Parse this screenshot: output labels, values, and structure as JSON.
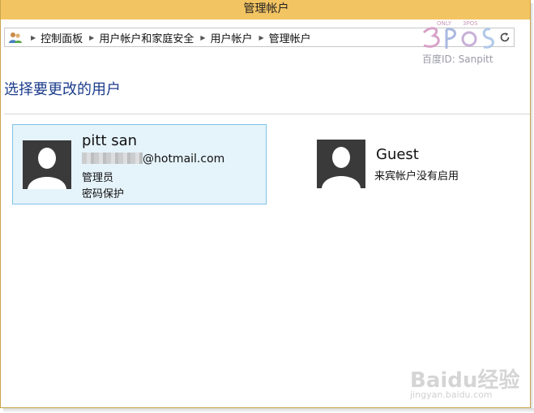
{
  "window": {
    "title": "管理帐户"
  },
  "addressbar": {
    "breadcrumbs": [
      "控制面板",
      "用户帐户和家庭安全",
      "用户帐户",
      "管理帐户"
    ],
    "icon": "users-icon",
    "refresh_icon": "refresh-icon"
  },
  "heading": "选择要更改的用户",
  "users": [
    {
      "name": "pitt san",
      "email_suffix": "@hotmail.com",
      "role": "管理员",
      "password_status": "密码保护",
      "selected": true
    },
    {
      "name": "Guest",
      "status": "来宾帐户没有启用",
      "selected": false
    }
  ],
  "watermarks": {
    "top": "百度ID: Sanpitt",
    "top_logo_small": "ONLY",
    "top_logo_small2": "3POS",
    "bottom_logo": "Baidu经验",
    "bottom_url": "jingyan.baidu.com"
  },
  "colors": {
    "titlebar": "#f3c462",
    "heading": "#1c3d8c",
    "selected_tile_bg": "#e5f3fb",
    "selected_tile_border": "#7ec3e8",
    "avatar_bg": "#3a3a3a"
  }
}
